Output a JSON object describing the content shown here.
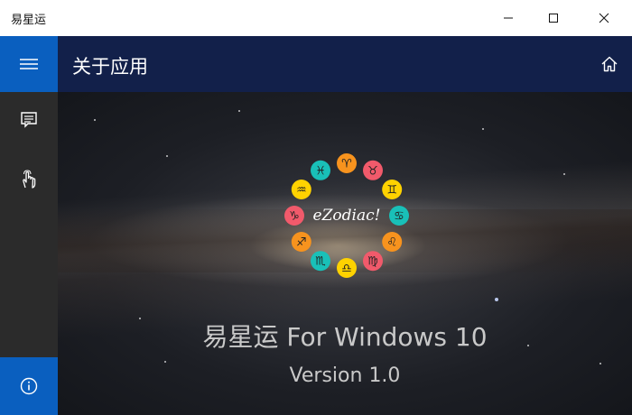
{
  "window": {
    "title": "易星运"
  },
  "header": {
    "title": "关于应用"
  },
  "nav": {
    "items": [
      {
        "name": "hamburger-menu-icon",
        "selected": true
      },
      {
        "name": "feedback-icon",
        "selected": false
      },
      {
        "name": "touch-gesture-icon",
        "selected": false
      },
      {
        "name": "info-icon",
        "selected": true
      }
    ]
  },
  "about": {
    "logo_text": "eZodiac!",
    "app_name": "易星运 For Windows 10",
    "version": "Version 1.0"
  },
  "zodiac_signs": [
    {
      "glyph": "♈",
      "color": "#f7931e"
    },
    {
      "glyph": "♉",
      "color": "#f15a6b"
    },
    {
      "glyph": "♊",
      "color": "#ffd200"
    },
    {
      "glyph": "♋",
      "color": "#19c0b8"
    },
    {
      "glyph": "♌",
      "color": "#f7931e"
    },
    {
      "glyph": "♍",
      "color": "#f15a6b"
    },
    {
      "glyph": "♎",
      "color": "#ffd200"
    },
    {
      "glyph": "♏",
      "color": "#19c0b8"
    },
    {
      "glyph": "♐",
      "color": "#f7931e"
    },
    {
      "glyph": "♑",
      "color": "#f15a6b"
    },
    {
      "glyph": "♒",
      "color": "#ffd200"
    },
    {
      "glyph": "♓",
      "color": "#19c0b8"
    }
  ],
  "colors": {
    "accent": "#0a5fbf",
    "header": "#12204a",
    "rail": "#2b2b2b"
  }
}
